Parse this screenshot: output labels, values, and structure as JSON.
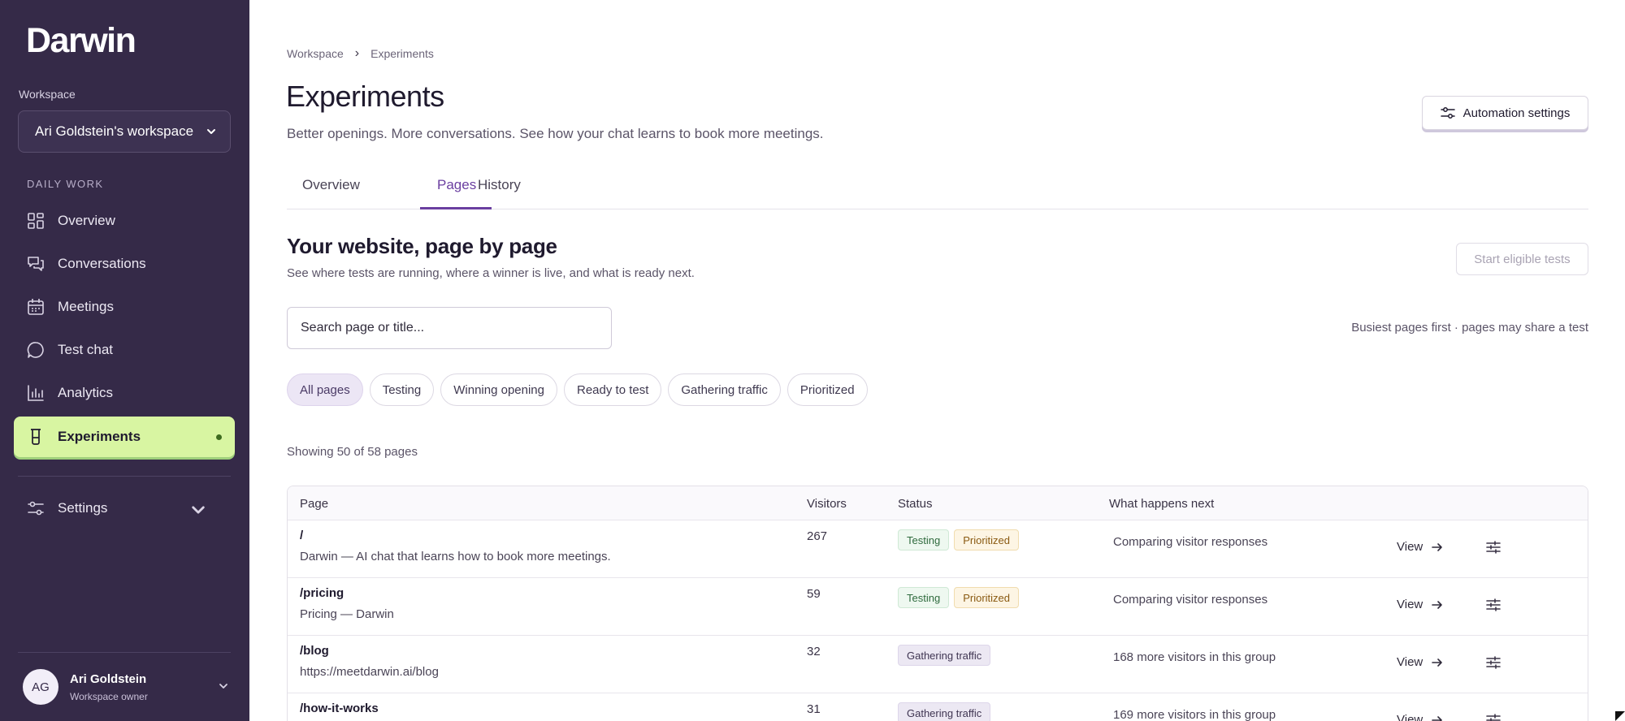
{
  "sidebar": {
    "logo": "Darwin",
    "workspace_label": "Workspace",
    "workspace_value": "Ari Goldstein's workspace",
    "section_label": "DAILY WORK",
    "items": [
      {
        "label": "Overview",
        "icon": "grid-icon"
      },
      {
        "label": "Conversations",
        "icon": "chat-bubbles-icon"
      },
      {
        "label": "Meetings",
        "icon": "calendar-icon"
      },
      {
        "label": "Test chat",
        "icon": "chat-bubble-icon"
      },
      {
        "label": "Analytics",
        "icon": "bar-chart-icon"
      },
      {
        "label": "Experiments",
        "icon": "beaker-icon",
        "active": true
      }
    ],
    "settings_label": "Settings",
    "user": {
      "initials": "AG",
      "name": "Ari Goldstein",
      "role": "Workspace owner"
    }
  },
  "header": {
    "breadcrumb": [
      "Workspace",
      "Experiments"
    ],
    "title": "Experiments",
    "subtitle": "Better openings. More conversations. See how your chat learns to book more meetings.",
    "automation_button": "Automation settings"
  },
  "tabs": [
    {
      "label": "Overview"
    },
    {
      "label": "Pages",
      "active": true
    },
    {
      "label": "History"
    }
  ],
  "section": {
    "title": "Your website, page by page",
    "subtitle": "See where tests are running, where a winner is live, and what is ready next.",
    "start_button": "Start eligible tests",
    "search_placeholder": "Search page or title...",
    "sort_note": "Busiest pages first · pages may share a test",
    "filters": [
      "All pages",
      "Testing",
      "Winning opening",
      "Ready to test",
      "Gathering traffic",
      "Prioritized"
    ],
    "showing": "Showing 50 of 58 pages"
  },
  "table": {
    "columns": [
      "Page",
      "Visitors",
      "Status",
      "What happens next"
    ],
    "view_label": "View",
    "rows": [
      {
        "path": "/",
        "title": "Darwin — AI chat that learns how to book more meetings.",
        "visitors": "267",
        "badges": [
          "Testing",
          "Prioritized"
        ],
        "next": "Comparing visitor responses"
      },
      {
        "path": "/pricing",
        "title": "Pricing — Darwin",
        "visitors": "59",
        "badges": [
          "Testing",
          "Prioritized"
        ],
        "next": "Comparing visitor responses"
      },
      {
        "path": "/blog",
        "title": "https://meetdarwin.ai/blog",
        "visitors": "32",
        "badges": [
          "Gathering traffic"
        ],
        "next": "168 more visitors in this group"
      },
      {
        "path": "/how-it-works",
        "title": "",
        "visitors": "31",
        "badges": [
          "Gathering traffic"
        ],
        "next": "169 more visitors in this group"
      }
    ]
  },
  "colors": {
    "sidebar_bg": "#352a48",
    "active_nav": "#d8f5a2",
    "accent": "#6b3fa0"
  }
}
